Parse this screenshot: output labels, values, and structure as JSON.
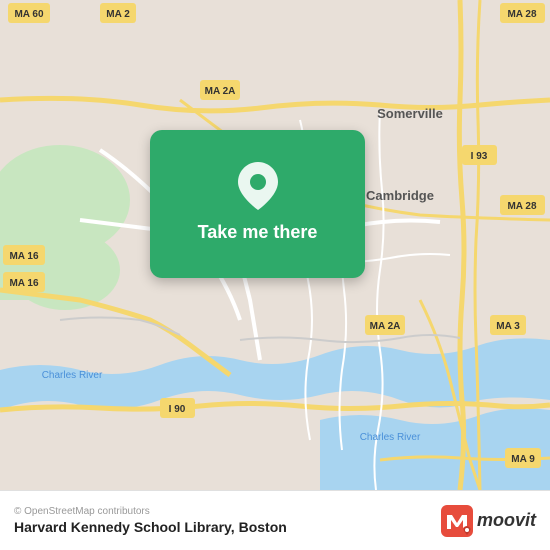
{
  "map": {
    "background_color": "#e8e0d8",
    "attribution": "© OpenStreetMap contributors",
    "city": "Boston"
  },
  "card": {
    "button_label": "Take me there",
    "pin_icon": "location-pin"
  },
  "bottom_bar": {
    "place_name": "Harvard Kennedy School Library, Boston",
    "logo_text": "moovit"
  },
  "road_labels": [
    {
      "id": "ma60",
      "text": "MA 60"
    },
    {
      "id": "ma2",
      "text": "MA 2"
    },
    {
      "id": "ma2a_top",
      "text": "MA 2A"
    },
    {
      "id": "ma28_top",
      "text": "MA 28"
    },
    {
      "id": "ma16_left",
      "text": "MA 16"
    },
    {
      "id": "ma16_mid",
      "text": "MA 16"
    },
    {
      "id": "i93",
      "text": "I 93"
    },
    {
      "id": "ma28_mid",
      "text": "MA 28"
    },
    {
      "id": "ma2a_bot",
      "text": "MA 2A"
    },
    {
      "id": "ma3",
      "text": "MA 3"
    },
    {
      "id": "i90",
      "text": "I 90"
    },
    {
      "id": "ma9",
      "text": "MA 9"
    }
  ],
  "area_labels": [
    {
      "id": "somerville",
      "text": "Somerville"
    },
    {
      "id": "cambridge",
      "text": "Cambridge"
    },
    {
      "id": "charles_river_1",
      "text": "Charles River"
    },
    {
      "id": "charles_river_2",
      "text": "Charles River"
    }
  ]
}
